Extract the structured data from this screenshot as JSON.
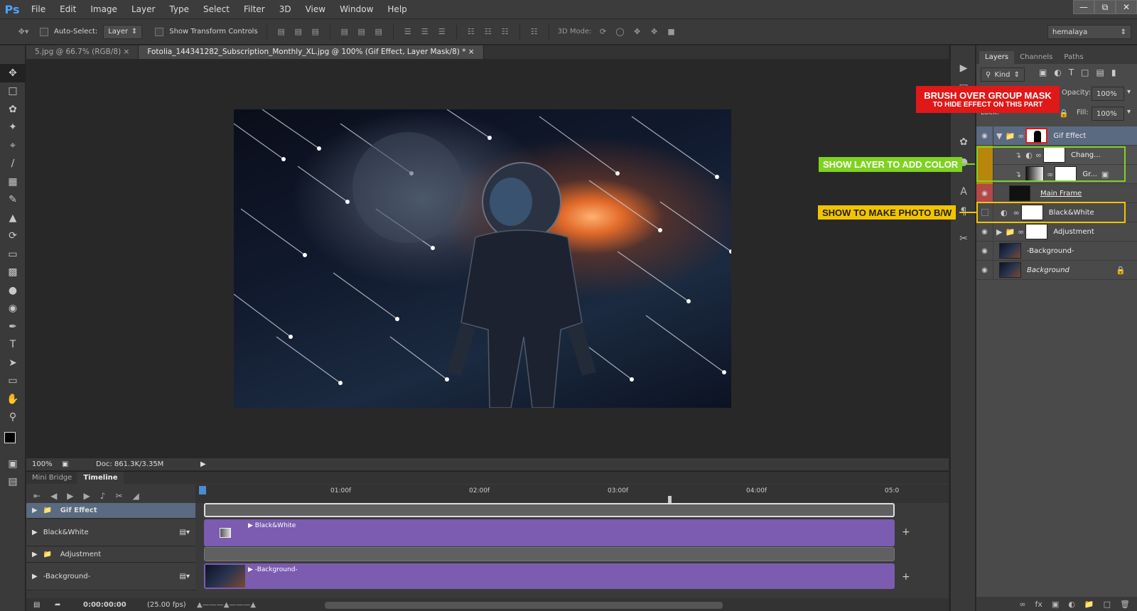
{
  "app": {
    "logo": "Ps"
  },
  "menu": [
    "File",
    "Edit",
    "Image",
    "Layer",
    "Type",
    "Select",
    "Filter",
    "3D",
    "View",
    "Window",
    "Help"
  ],
  "options": {
    "auto_select_label": "Auto-Select:",
    "auto_select_value": "Layer",
    "show_transform_label": "Show Transform Controls",
    "mode_label": "3D Mode:",
    "workspace": "hemalaya"
  },
  "doc_tabs": [
    {
      "label": "5.jpg @ 66.7% (RGB/8)"
    },
    {
      "label": "Fotolia_144341282_Subscription_Monthly_XL.jpg @ 100% (Gif Effect, Layer Mask/8) *"
    }
  ],
  "status": {
    "zoom": "100%",
    "doc": "Doc: 861.3K/3.35M"
  },
  "layers_panel": {
    "tabs": [
      "Layers",
      "Channels",
      "Paths"
    ],
    "kind": "Kind",
    "opacity_label": "Opacity:",
    "opacity_value": "100%",
    "fill_label": "Fill:",
    "fill_value": "100%",
    "lock_label": "Lock:",
    "layers": [
      {
        "name": "Gif Effect"
      },
      {
        "name": "Chang..."
      },
      {
        "name": "Gr..."
      },
      {
        "name": "Main Frame"
      },
      {
        "name": "Black&White"
      },
      {
        "name": "Adjustment"
      },
      {
        "name": "-Background-"
      },
      {
        "name": "Background"
      }
    ]
  },
  "annotations": {
    "brush_title": "BRUSH OVER GROUP MASK",
    "brush_sub": "TO HIDE EFFECT ON THIS PART",
    "color": "SHOW LAYER TO ADD COLOR",
    "bw": "SHOW TO MAKE PHOTO B/W"
  },
  "timeline": {
    "tabs": [
      "Mini Bridge",
      "Timeline"
    ],
    "ruler": [
      "01:00f",
      "02:00f",
      "03:00f",
      "04:00f",
      "05:0"
    ],
    "tracks": [
      {
        "label": "Gif Effect"
      },
      {
        "label": "Black&White",
        "clip": "Black&White"
      },
      {
        "label": "Adjustment"
      },
      {
        "label": "-Background-",
        "clip": "-Background-"
      }
    ],
    "time": "0:00:00:00",
    "fps": "(25.00 fps)"
  },
  "colors": {
    "accent": "#4aa3ff",
    "annotation_red": "#e01818",
    "annotation_green": "#7ed321",
    "annotation_yellow": "#f2c400",
    "clip_purple": "#7b5cb0"
  }
}
